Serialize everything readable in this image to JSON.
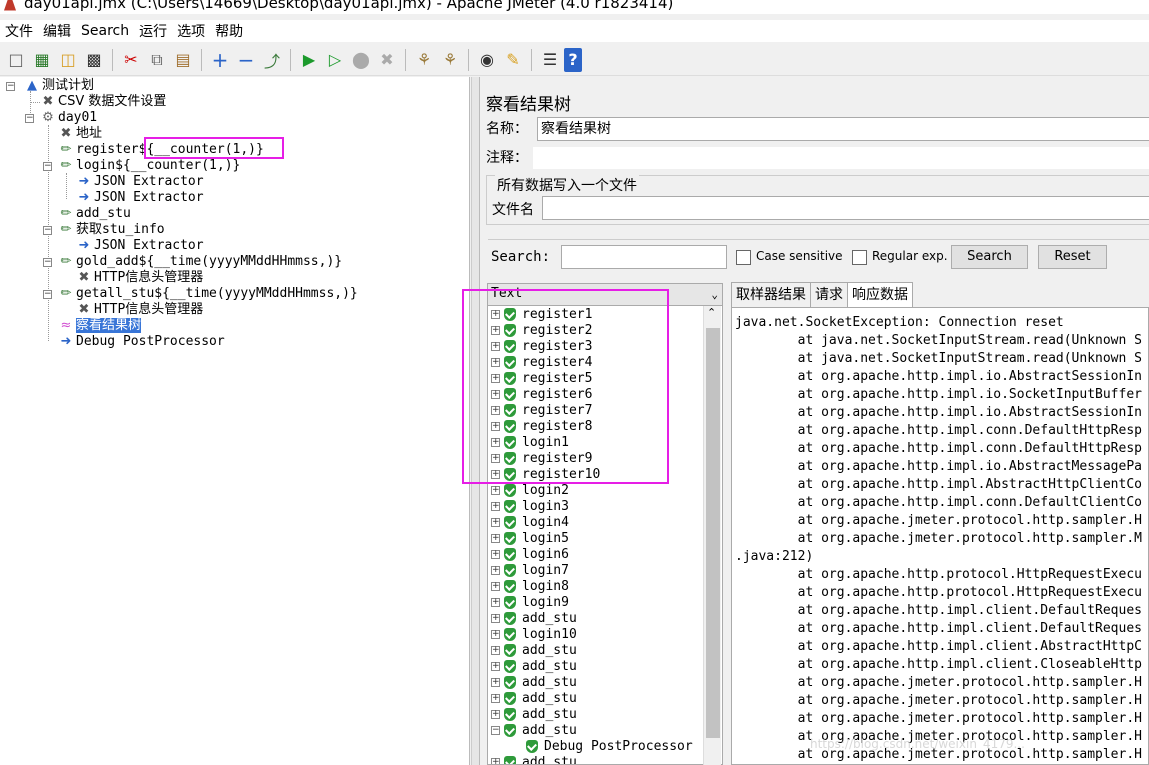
{
  "window": {
    "title": "day01api.jmx (C:\\Users\\14669\\Desktop\\day01api.jmx) - Apache JMeter (4.0 r1823414)"
  },
  "menu": [
    "文件",
    "编辑",
    "Search",
    "运行",
    "选项",
    "帮助"
  ],
  "toolbar": {
    "icons": [
      "new-icon",
      "templates-icon",
      "open-icon",
      "save-icon",
      "cut-icon",
      "copy-icon",
      "paste-icon",
      "expand-icon",
      "collapse-icon",
      "toggle-icon",
      "start-icon",
      "start-no-pause-icon",
      "stop-icon",
      "shutdown-icon",
      "clear-icon",
      "clear-all-icon",
      "search-icon",
      "reset-search-icon",
      "function-helper-icon",
      "help-icon"
    ]
  },
  "tree": {
    "root": "测试计划",
    "csv": "CSV 数据文件设置",
    "group": "day01",
    "items": {
      "addr": "地址",
      "register": "register${__counter(1,)}",
      "login": "login${__counter(1,)}",
      "json1": "JSON Extractor",
      "json2": "JSON Extractor",
      "add_stu": "add_stu",
      "get_stu": "获取stu_info",
      "json3": "JSON Extractor",
      "gold_add": "gold_add${__time(yyyyMMddHHmmss,)}",
      "header1": "HTTP信息头管理器",
      "getall": "getall_stu${__time(yyyyMMddHHmmss,)}",
      "header2": "HTTP信息头管理器",
      "result_tree": "察看结果树",
      "debug": "Debug PostProcessor"
    }
  },
  "panel": {
    "title": "察看结果树",
    "name_label": "名称：",
    "name_value": "察看结果树",
    "comment_label": "注释：",
    "comment_value": "",
    "file_group": "所有数据写入一个文件",
    "file_label": "文件名",
    "file_value": ""
  },
  "search": {
    "label": "Search:",
    "value": "",
    "case_sensitive": "Case sensitive",
    "regex": "Regular exp.",
    "search_btn": "Search",
    "reset_btn": "Reset"
  },
  "results": {
    "renderer": "Text",
    "items": [
      "register1",
      "register2",
      "register3",
      "register4",
      "register5",
      "register6",
      "register7",
      "register8",
      "login1",
      "register9",
      "register10",
      "login2",
      "login3",
      "login4",
      "login5",
      "login6",
      "login7",
      "login8",
      "login9",
      "add_stu",
      "login10",
      "add_stu",
      "add_stu",
      "add_stu",
      "add_stu",
      "add_stu",
      "add_stu"
    ],
    "child": "Debug PostProcessor",
    "last": "add_stu"
  },
  "tabs": [
    "取样器结果",
    "请求",
    "响应数据"
  ],
  "response_lines": [
    "java.net.SocketException: Connection reset",
    "        at java.net.SocketInputStream.read(Unknown S",
    "        at java.net.SocketInputStream.read(Unknown S",
    "        at org.apache.http.impl.io.AbstractSessionIn",
    "        at org.apache.http.impl.io.SocketInputBuffer",
    "        at org.apache.http.impl.io.AbstractSessionIn",
    "        at org.apache.http.impl.conn.DefaultHttpResp",
    "        at org.apache.http.impl.conn.DefaultHttpResp",
    "        at org.apache.http.impl.io.AbstractMessagePa",
    "        at org.apache.http.impl.AbstractHttpClientCo",
    "        at org.apache.http.impl.conn.DefaultClientCo",
    "        at org.apache.jmeter.protocol.http.sampler.H",
    "        at org.apache.jmeter.protocol.http.sampler.M",
    ".java:212)",
    "        at org.apache.http.protocol.HttpRequestExecu",
    "        at org.apache.http.protocol.HttpRequestExecu",
    "        at org.apache.http.impl.client.DefaultReques",
    "        at org.apache.http.impl.client.DefaultReques",
    "        at org.apache.http.impl.client.AbstractHttpC",
    "        at org.apache.http.impl.client.CloseableHttp",
    "        at org.apache.jmeter.protocol.http.sampler.H",
    "        at org.apache.jmeter.protocol.http.sampler.H",
    "        at org.apache.jmeter.protocol.http.sampler.H",
    "        at org.apache.jmeter.protocol.http.sampler.H",
    "        at org.apache.jmeter.protocol.http.sampler.H"
  ],
  "watermark": "https://blog.csdn.net/weixin_4179..."
}
